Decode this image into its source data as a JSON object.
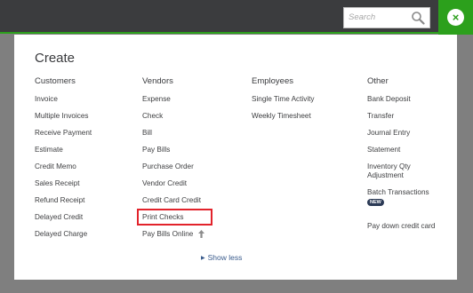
{
  "search": {
    "placeholder": "Search"
  },
  "create_title": "Create",
  "columns": [
    {
      "header": "Customers",
      "items": [
        "Invoice",
        "Multiple Invoices",
        "Receive Payment",
        "Estimate",
        "Credit Memo",
        "Sales Receipt",
        "Refund Receipt",
        "Delayed Credit",
        "Delayed Charge"
      ]
    },
    {
      "header": "Vendors",
      "items": [
        "Expense",
        "Check",
        "Bill",
        "Pay Bills",
        "Purchase Order",
        "Vendor Credit",
        "Credit Card Credit",
        "Print Checks",
        "Pay Bills Online"
      ]
    },
    {
      "header": "Employees",
      "items": [
        "Single Time Activity",
        "Weekly Timesheet"
      ]
    },
    {
      "header": "Other",
      "items": [
        "Bank Deposit",
        "Transfer",
        "Journal Entry",
        "Statement",
        "Inventory Qty Adjustment",
        "Batch Transactions",
        "Pay down credit card"
      ],
      "badge": "NEW"
    }
  ],
  "show_less": "Show less",
  "colors": {
    "brand_green": "#2ca01c",
    "highlight_red": "#e2232b",
    "topbar": "#3b3c3e"
  },
  "icons": {
    "search": "magnifier-icon",
    "close": "close-icon",
    "show_less": "triangle-right-icon",
    "pay_bills_online": "arrow-up-icon"
  }
}
